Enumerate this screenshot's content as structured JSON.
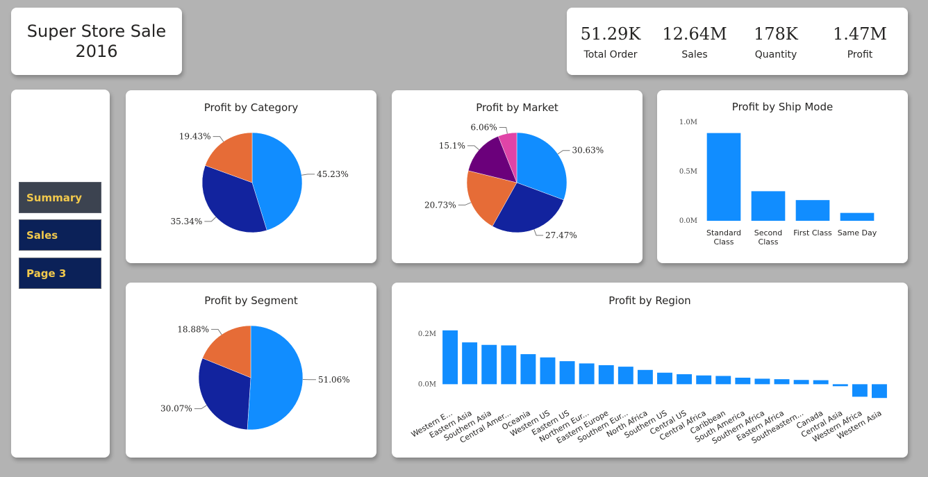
{
  "header": {
    "title_line1": "Super Store Sale",
    "title_line2": "2016"
  },
  "kpis": [
    {
      "value": "51.29K",
      "label": "Total Order"
    },
    {
      "value": "12.64M",
      "label": "Sales"
    },
    {
      "value": "178K",
      "label": "Quantity"
    },
    {
      "value": "1.47M",
      "label": "Profit"
    }
  ],
  "nav": [
    {
      "label": "Summary",
      "active": true
    },
    {
      "label": "Sales",
      "active": false
    },
    {
      "label": "Page 3",
      "active": false
    }
  ],
  "colors": {
    "blue": "#118dff",
    "navy": "#12239e",
    "orange": "#e66c37",
    "purple": "#6b007b",
    "pink": "#e044a7",
    "nav_active": "#3c4350",
    "nav_normal": "#0b2158",
    "nav_text": "#f2c94c",
    "background": "#b3b3b3"
  },
  "chart_data": [
    {
      "id": "category",
      "type": "pie",
      "title": "Profit by Category",
      "slices": [
        {
          "label": "45.23%",
          "value": 45.23,
          "color": "#118dff"
        },
        {
          "label": "35.34%",
          "value": 35.34,
          "color": "#12239e"
        },
        {
          "label": "19.43%",
          "value": 19.43,
          "color": "#e66c37"
        }
      ]
    },
    {
      "id": "market",
      "type": "pie",
      "title": "Profit by Market",
      "slices": [
        {
          "label": "30.63%",
          "value": 30.63,
          "color": "#118dff"
        },
        {
          "label": "27.47%",
          "value": 27.47,
          "color": "#12239e"
        },
        {
          "label": "20.73%",
          "value": 20.73,
          "color": "#e66c37"
        },
        {
          "label": "15.1%",
          "value": 15.1,
          "color": "#6b007b"
        },
        {
          "label": "6.06%",
          "value": 6.06,
          "color": "#e044a7"
        }
      ]
    },
    {
      "id": "shipmode",
      "type": "bar",
      "title": "Profit by Ship Mode",
      "categories": [
        "Standard Class",
        "Second Class",
        "First Class",
        "Same Day"
      ],
      "values": [
        0.89,
        0.3,
        0.21,
        0.08
      ],
      "yticks": [
        "0.0M",
        "0.5M",
        "1.0M"
      ],
      "ylim": [
        0,
        1.0
      ],
      "color": "#118dff"
    },
    {
      "id": "segment",
      "type": "pie",
      "title": "Profit by Segment",
      "slices": [
        {
          "label": "51.06%",
          "value": 51.06,
          "color": "#118dff"
        },
        {
          "label": "30.07%",
          "value": 30.07,
          "color": "#12239e"
        },
        {
          "label": "18.88%",
          "value": 18.88,
          "color": "#e66c37"
        }
      ]
    },
    {
      "id": "region",
      "type": "bar",
      "title": "Profit by Region",
      "categories": [
        "Western E...",
        "Eastern Asia",
        "Southern Asia",
        "Central Amer...",
        "Oceania",
        "Western US",
        "Eastern US",
        "Northern Eur...",
        "Eastern Europe",
        "Southern Eur...",
        "North Africa",
        "Southern US",
        "Central US",
        "Central Africa",
        "Caribbean",
        "South America",
        "Southern Africa",
        "Eastern Africa",
        "Southeastern...",
        "Canada",
        "Central Asia",
        "Western Africa",
        "Western Asia"
      ],
      "values": [
        0.215,
        0.167,
        0.157,
        0.155,
        0.12,
        0.107,
        0.092,
        0.083,
        0.076,
        0.07,
        0.057,
        0.046,
        0.04,
        0.035,
        0.033,
        0.026,
        0.022,
        0.02,
        0.017,
        0.016,
        -0.008,
        -0.05,
        -0.055
      ],
      "yticks": [
        "0.0M",
        "0.2M"
      ],
      "ylim": [
        -0.06,
        0.22
      ],
      "color": "#118dff"
    }
  ]
}
